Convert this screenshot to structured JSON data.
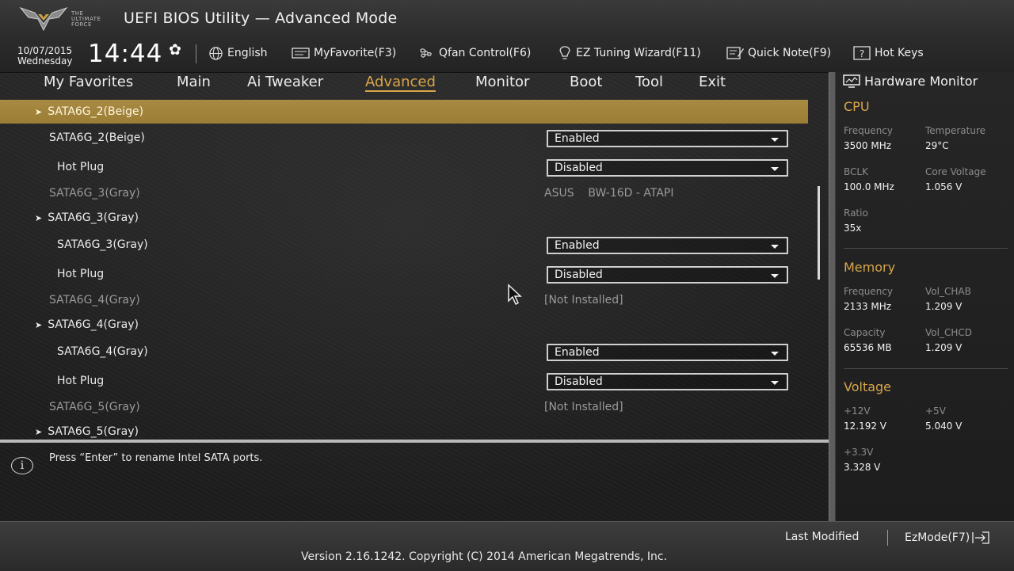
{
  "header": {
    "logo_text": [
      "THE",
      "ULTIMATE",
      "FORCE"
    ],
    "title": "UEFI BIOS Utility — Advanced Mode",
    "date": "10/07/2015",
    "day": "Wednesday",
    "time": "14:44",
    "tools": [
      {
        "icon": "globe-icon",
        "label": "English"
      },
      {
        "icon": "myfavorite-icon",
        "label": "MyFavorite(F3)"
      },
      {
        "icon": "fan-icon",
        "label": "Qfan Control(F6)"
      },
      {
        "icon": "lightbulb-icon",
        "label": "EZ Tuning Wizard(F11)"
      },
      {
        "icon": "note-icon",
        "label": "Quick Note(F9)"
      },
      {
        "icon": "help-box-icon",
        "label": "Hot Keys"
      }
    ]
  },
  "tabs": [
    "My Favorites",
    "Main",
    "Ai Tweaker",
    "Advanced",
    "Monitor",
    "Boot",
    "Tool",
    "Exit"
  ],
  "active_tab": "Advanced",
  "rows": [
    {
      "label": "SATA6G_2(Beige)",
      "type": "submenu",
      "selected": true
    },
    {
      "label": "SATA6G_2(Beige)",
      "type": "dropdown",
      "value": "Enabled"
    },
    {
      "label": "Hot Plug",
      "type": "dropdown",
      "value": "Disabled"
    },
    {
      "label": "SATA6G_3(Gray)",
      "type": "info",
      "value": "ASUS    BW-16D - ATAPI"
    },
    {
      "label": "SATA6G_3(Gray)",
      "type": "submenu"
    },
    {
      "label": "SATA6G_3(Gray)",
      "type": "dropdown",
      "value": "Enabled"
    },
    {
      "label": "Hot Plug",
      "type": "dropdown",
      "value": "Disabled"
    },
    {
      "label": "SATA6G_4(Gray)",
      "type": "info",
      "value": "[Not Installed]"
    },
    {
      "label": "SATA6G_4(Gray)",
      "type": "submenu"
    },
    {
      "label": "SATA6G_4(Gray)",
      "type": "dropdown",
      "value": "Enabled"
    },
    {
      "label": "Hot Plug",
      "type": "dropdown",
      "value": "Disabled"
    },
    {
      "label": "SATA6G_5(Gray)",
      "type": "info",
      "value": "[Not Installed]"
    },
    {
      "label": "SATA6G_5(Gray)",
      "type": "submenu"
    }
  ],
  "help_text": "Press “Enter” to rename Intel SATA ports.",
  "hardware_monitor": {
    "title": "Hardware Monitor",
    "cpu": {
      "title": "CPU",
      "frequency_label": "Frequency",
      "frequency": "3500 MHz",
      "temperature_label": "Temperature",
      "temperature": "29°C",
      "bclk_label": "BCLK",
      "bclk": "100.0 MHz",
      "core_voltage_label": "Core Voltage",
      "core_voltage": "1.056 V",
      "ratio_label": "Ratio",
      "ratio": "35x"
    },
    "memory": {
      "title": "Memory",
      "frequency_label": "Frequency",
      "frequency": "2133 MHz",
      "vol_chab_label": "Vol_CHAB",
      "vol_chab": "1.209 V",
      "capacity_label": "Capacity",
      "capacity": "65536 MB",
      "vol_chcd_label": "Vol_CHCD",
      "vol_chcd": "1.209 V"
    },
    "voltage": {
      "title": "Voltage",
      "v12_label": "+12V",
      "v12": "12.192 V",
      "v5_label": "+5V",
      "v5": "5.040 V",
      "v33_label": "+3.3V",
      "v33": "3.328 V"
    }
  },
  "footer": {
    "last_modified": "Last Modified",
    "ezmode": "EzMode(F7)",
    "version": "Version 2.16.1242. Copyright (C) 2014 American Megatrends, Inc."
  },
  "colors": {
    "accent": "#d9a64a",
    "highlight": "#a88a42"
  }
}
